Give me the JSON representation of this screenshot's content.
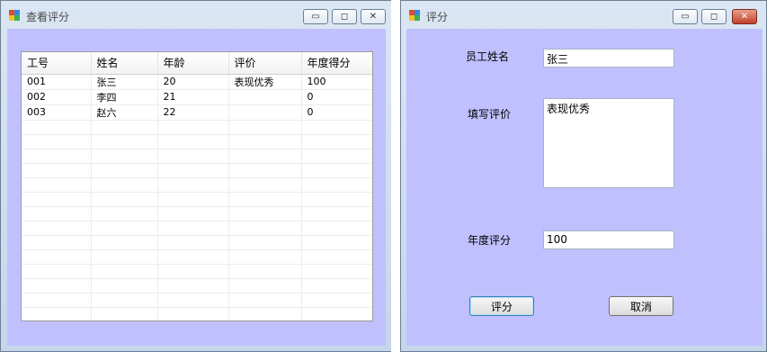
{
  "left_window": {
    "title": "查看评分",
    "controls": {
      "minimize": "▭",
      "maximize": "◻",
      "close": "✕"
    },
    "grid": {
      "columns": [
        "工号",
        "姓名",
        "年龄",
        "评价",
        "年度得分"
      ],
      "rows": [
        [
          "001",
          "张三",
          "20",
          "表现优秀",
          "100"
        ],
        [
          "002",
          "李四",
          "21",
          "",
          "0"
        ],
        [
          "003",
          "赵六",
          "22",
          "",
          "0"
        ]
      ]
    }
  },
  "right_window": {
    "title": "评分",
    "controls": {
      "minimize": "▭",
      "maximize": "◻",
      "close": "✕"
    },
    "form": {
      "name_label": "员工姓名",
      "name_value": "张三",
      "review_label": "填写评价",
      "review_value": "表现优秀",
      "score_label": "年度评分",
      "score_value": "100",
      "submit_label": "评分",
      "cancel_label": "取消"
    }
  },
  "colors": {
    "client_bg": "#c0c0ff",
    "close_button": "#c1402b"
  }
}
